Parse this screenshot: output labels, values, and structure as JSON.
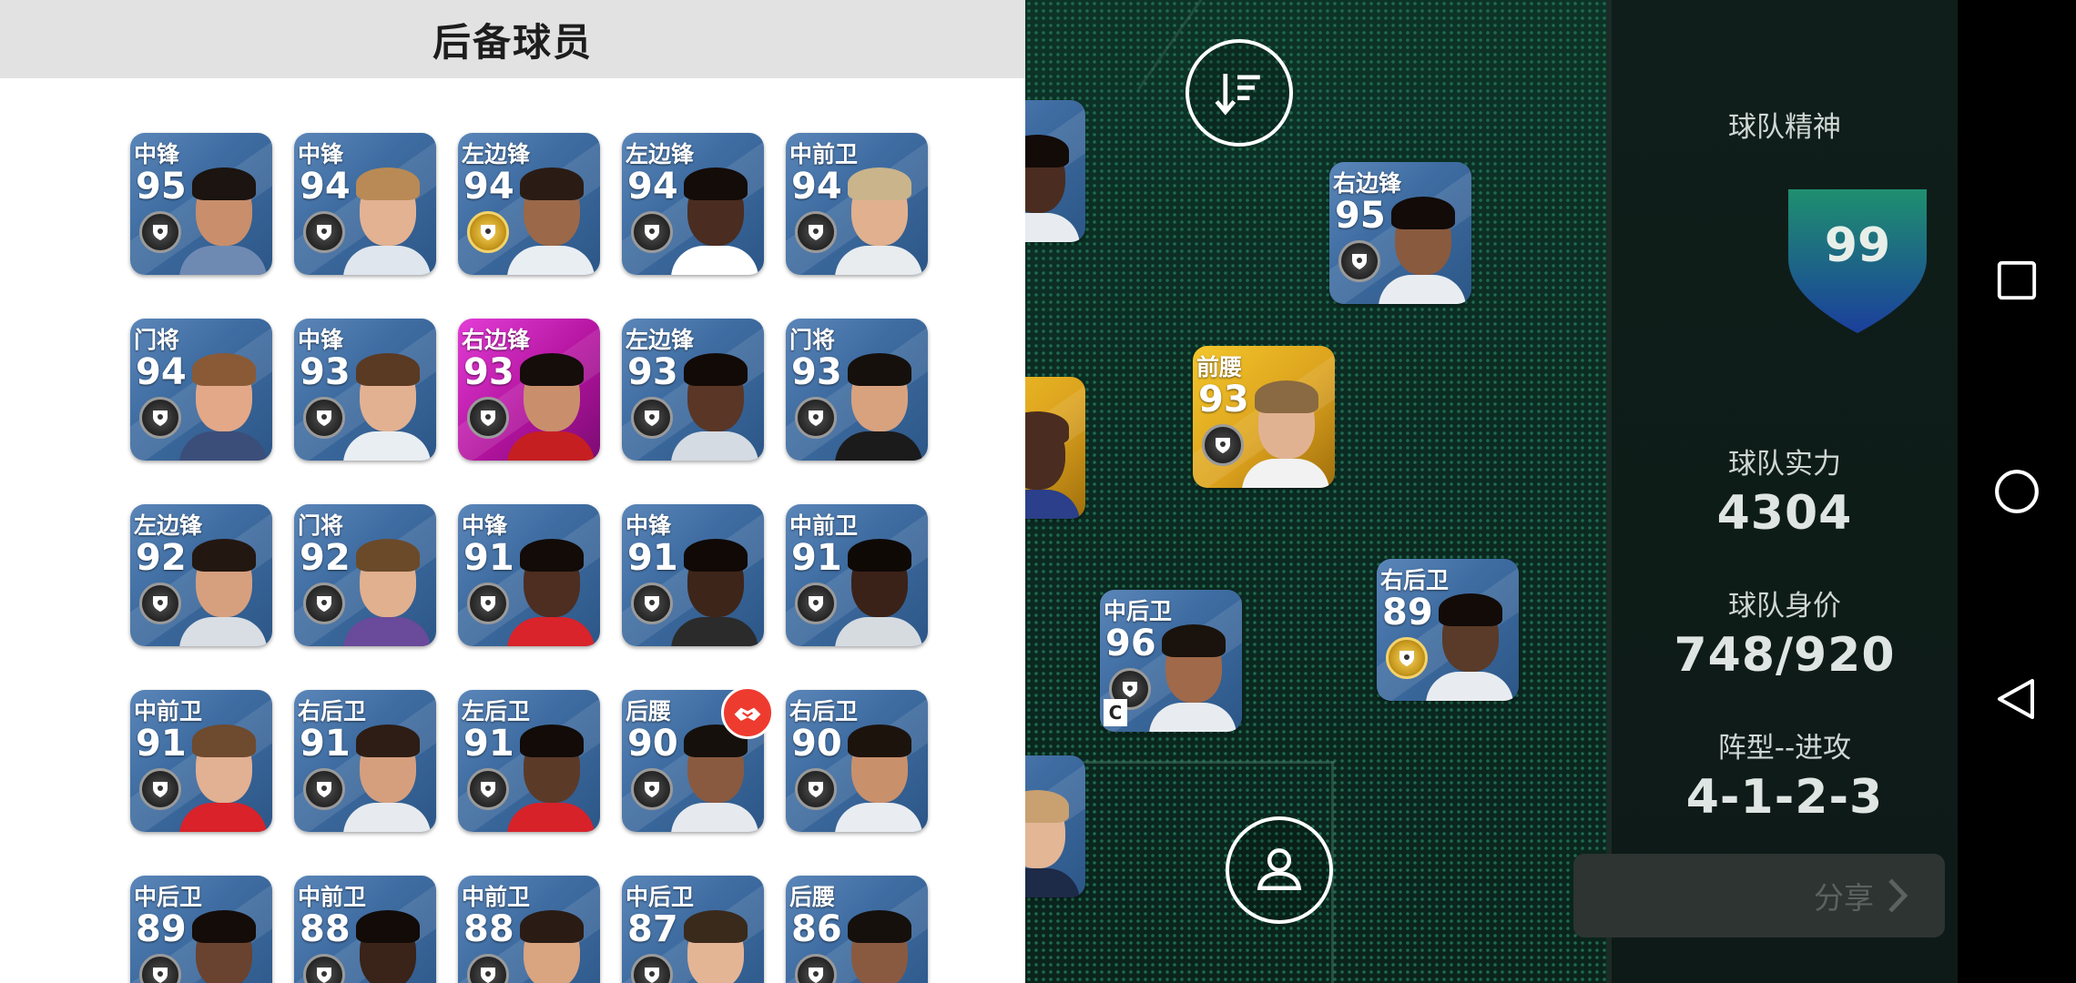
{
  "reserve": {
    "title": "后备球员",
    "cards": [
      {
        "pos": "中锋",
        "ovr": "95",
        "theme": "blue",
        "skin": "#c98e6b",
        "hair": "#1b1410",
        "shirt": "#6e8ab3",
        "medal": "black"
      },
      {
        "pos": "中锋",
        "ovr": "94",
        "theme": "blue",
        "skin": "#e3b292",
        "hair": "#b98a55",
        "shirt": "#dfe6ee",
        "medal": "black"
      },
      {
        "pos": "左边锋",
        "ovr": "94",
        "theme": "blue",
        "skin": "#9b6849",
        "hair": "#2a1c14",
        "shirt": "#e9eef3",
        "medal": "gold"
      },
      {
        "pos": "左边锋",
        "ovr": "94",
        "theme": "blue",
        "skin": "#4a2d20",
        "hair": "#140c08",
        "shirt": "#ffffff",
        "medal": "black"
      },
      {
        "pos": "中前卫",
        "ovr": "94",
        "theme": "blue",
        "skin": "#e0b08f",
        "hair": "#c9b48c",
        "shirt": "#e8ecef",
        "medal": "black"
      },
      {
        "pos": "门将",
        "ovr": "94",
        "theme": "blue",
        "skin": "#e3a888",
        "hair": "#8a5a36",
        "shirt": "#3b4e7a",
        "medal": "black"
      },
      {
        "pos": "中锋",
        "ovr": "93",
        "theme": "blue",
        "skin": "#e2b191",
        "hair": "#5a3a22",
        "shirt": "#e9eef3",
        "medal": "black"
      },
      {
        "pos": "右边锋",
        "ovr": "93",
        "theme": "pink",
        "skin": "#c98f6c",
        "hair": "#140d0a",
        "shirt": "#c61f22",
        "medal": "black"
      },
      {
        "pos": "左边锋",
        "ovr": "93",
        "theme": "blue",
        "skin": "#5a3626",
        "hair": "#120a06",
        "shirt": "#d5dbe2",
        "medal": "black"
      },
      {
        "pos": "门将",
        "ovr": "93",
        "theme": "blue",
        "skin": "#d8a27f",
        "hair": "#15100c",
        "shirt": "#1b1b1b",
        "medal": "black"
      },
      {
        "pos": "左边锋",
        "ovr": "92",
        "theme": "blue",
        "skin": "#d6a07e",
        "hair": "#231711",
        "shirt": "#d9dee4",
        "medal": "black"
      },
      {
        "pos": "门将",
        "ovr": "92",
        "theme": "blue",
        "skin": "#e1b08e",
        "hair": "#6b4a2a",
        "shirt": "#6a4a9a",
        "medal": "black"
      },
      {
        "pos": "中锋",
        "ovr": "91",
        "theme": "blue",
        "skin": "#4d2e21",
        "hair": "#120b08",
        "shirt": "#d8242a",
        "medal": "black"
      },
      {
        "pos": "中锋",
        "ovr": "91",
        "theme": "blue",
        "skin": "#3e2519",
        "hair": "#100906",
        "shirt": "#2b2b2b",
        "medal": "black"
      },
      {
        "pos": "中前卫",
        "ovr": "91",
        "theme": "blue",
        "skin": "#3a2218",
        "hair": "#0f0906",
        "shirt": "#d6dbe0",
        "medal": "black"
      },
      {
        "pos": "中前卫",
        "ovr": "91",
        "theme": "blue",
        "skin": "#e2b092",
        "hair": "#6e4a2e",
        "shirt": "#d9222a",
        "medal": "black"
      },
      {
        "pos": "右后卫",
        "ovr": "91",
        "theme": "blue",
        "skin": "#d59f7e",
        "hair": "#2d1d14",
        "shirt": "#e7ebef",
        "medal": "black"
      },
      {
        "pos": "左后卫",
        "ovr": "91",
        "theme": "blue",
        "skin": "#5c3a28",
        "hair": "#120b08",
        "shirt": "#d7222a",
        "medal": "black"
      },
      {
        "pos": "后腰",
        "ovr": "90",
        "theme": "blue",
        "skin": "#8a5a40",
        "hair": "#15100c",
        "shirt": "#e6eaee",
        "medal": "black"
      },
      {
        "pos": "右后卫",
        "ovr": "90",
        "theme": "blue",
        "skin": "#c9906c",
        "hair": "#1d130d",
        "shirt": "#e9edf1",
        "medal": "black"
      },
      {
        "pos": "中后卫",
        "ovr": "89",
        "theme": "blue",
        "skin": "#6a4230",
        "hair": "#140c08",
        "shirt": "#d2232a",
        "medal": "black"
      },
      {
        "pos": "中前卫",
        "ovr": "88",
        "theme": "blue",
        "skin": "#3a2318",
        "hair": "#120b08",
        "shirt": "#e5e9ed",
        "medal": "black"
      },
      {
        "pos": "中前卫",
        "ovr": "88",
        "theme": "blue",
        "skin": "#d9a480",
        "hair": "#2a1c14",
        "shirt": "#d4222a",
        "medal": "black"
      },
      {
        "pos": "中后卫",
        "ovr": "87",
        "theme": "blue",
        "skin": "#e4b595",
        "hair": "#3a2a1c",
        "shirt": "#e8ecf0",
        "medal": "black"
      },
      {
        "pos": "后腰",
        "ovr": "86",
        "theme": "blue",
        "skin": "#8a5a40",
        "hair": "#15100c",
        "shirt": "#d5dbe1",
        "medal": "black"
      }
    ]
  },
  "pitch": {
    "players": [
      {
        "id": "pitch-player-edge-top",
        "pos": "",
        "ovr": "",
        "theme": "blue",
        "skin": "#4a2d20",
        "hair": "#120b08",
        "shirt": "#e8ecf0",
        "medal": "none"
      },
      {
        "id": "pitch-player-rw",
        "pos": "右边锋",
        "ovr": "95",
        "theme": "blue",
        "skin": "#8a5a3e",
        "hair": "#120b08",
        "shirt": "#e9edf1",
        "medal": "black"
      },
      {
        "id": "pitch-player-am",
        "pos": "前腰",
        "ovr": "93",
        "theme": "gold",
        "skin": "#e1b292",
        "hair": "#8a6a42",
        "shirt": "#f2f2f2",
        "medal": "black"
      },
      {
        "id": "pitch-player-edge-mid",
        "pos": "",
        "ovr": "",
        "theme": "gold",
        "skin": "#4a2d20",
        "hair": "#4a2d20",
        "shirt": "#2b3f8a",
        "medal": "none"
      },
      {
        "id": "pitch-player-cb",
        "pos": "中后卫",
        "ovr": "96",
        "theme": "blue",
        "skin": "#a0694a",
        "hair": "#1a120c",
        "shirt": "#e8ecf0",
        "medal": "black",
        "captain": "C"
      },
      {
        "id": "pitch-player-rb",
        "pos": "右后卫",
        "ovr": "89",
        "theme": "blue",
        "skin": "#5a3a28",
        "hair": "#120b08",
        "shirt": "#e8ecf0",
        "medal": "gold"
      },
      {
        "id": "pitch-player-edge-bottom",
        "pos": "",
        "ovr": "",
        "theme": "blue",
        "skin": "#e3b696",
        "hair": "#c9a070",
        "shirt": "#1d2a48",
        "medal": "none"
      }
    ]
  },
  "stats": {
    "spirit_label": "球队精神",
    "spirit_value": "99",
    "strength_label": "球队实力",
    "strength_value": "4304",
    "value_label": "球队身价",
    "value_value": "748/920",
    "formation_label": "阵型--进攻",
    "formation_value": "4-1-2-3",
    "share_label": "分享"
  },
  "icons": {
    "sort": "sort-icon",
    "profile": "person-icon",
    "trade": "handshake-icon",
    "nav_recent": "square-icon",
    "nav_home": "circle-icon",
    "nav_back": "triangle-back-icon"
  },
  "colors": {
    "card_blue": "#3f6da2",
    "card_pink": "#b3139e",
    "card_gold": "#dca21d",
    "pitch_green": "#1f6a4f",
    "shield_top": "#1f8f6f",
    "shield_bottom": "#1b3f9c"
  }
}
